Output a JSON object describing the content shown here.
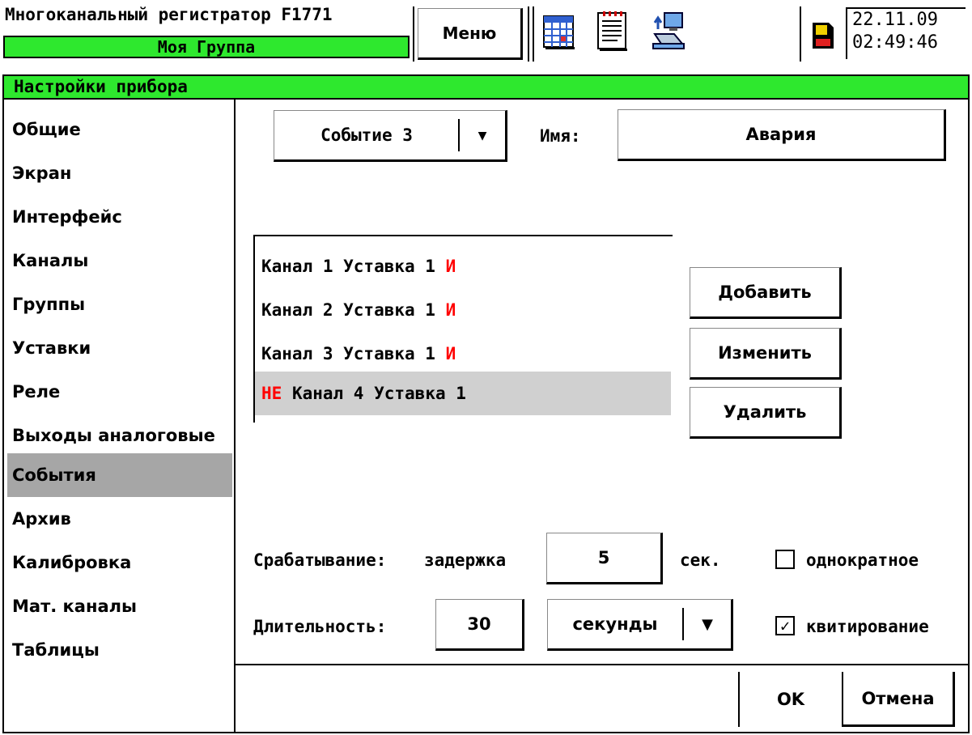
{
  "header": {
    "device_title": "Многоканальный регистратор F1771",
    "group_name": "Моя Группа",
    "menu_label": "Меню",
    "date": "22.11.09",
    "time": "02:49:46",
    "toolbar_icons": [
      "table-icon",
      "report-icon",
      "network-icon",
      "storage-card-icon"
    ]
  },
  "panel": {
    "title": "Настройки прибора"
  },
  "sidebar": {
    "items": [
      {
        "label": "Общие"
      },
      {
        "label": "Экран"
      },
      {
        "label": "Интерфейс"
      },
      {
        "label": "Каналы"
      },
      {
        "label": "Группы"
      },
      {
        "label": "Уставки"
      },
      {
        "label": "Реле"
      },
      {
        "label": "Выходы аналоговые"
      },
      {
        "label": "События"
      },
      {
        "label": "Архив"
      },
      {
        "label": "Калибровка"
      },
      {
        "label": "Мат. каналы"
      },
      {
        "label": "Таблицы"
      }
    ],
    "active_index": 8
  },
  "event": {
    "selected": "Событие 3",
    "name_label": "Имя:",
    "name_value": "Авария"
  },
  "conditions": [
    {
      "prefix": "",
      "text": "Канал 1 Уставка 1",
      "suffix": "И"
    },
    {
      "prefix": "",
      "text": "Канал 2 Уставка 1",
      "suffix": "И"
    },
    {
      "prefix": "",
      "text": "Канал 3 Уставка 1",
      "suffix": "И"
    },
    {
      "prefix": "НЕ",
      "text": "Канал 4 Уставка 1",
      "suffix": ""
    }
  ],
  "actions": {
    "add": "Добавить",
    "edit": "Изменить",
    "delete": "Удалить"
  },
  "trigger": {
    "label": "Срабатывание:",
    "delay_label": "задержка",
    "delay_value": "5",
    "unit": "сек.",
    "once_label": "однократное",
    "once_checked": false
  },
  "duration": {
    "label": "Длительность:",
    "value": "30",
    "unit_selected": "секунды",
    "ack_label": "квитирование",
    "ack_checked": true
  },
  "footer": {
    "ok": "OK",
    "cancel": "Отмена"
  },
  "colors": {
    "accent_green": "#2ee82e",
    "selection_gray": "#a6a6a6",
    "logic_red": "#ff0000"
  }
}
